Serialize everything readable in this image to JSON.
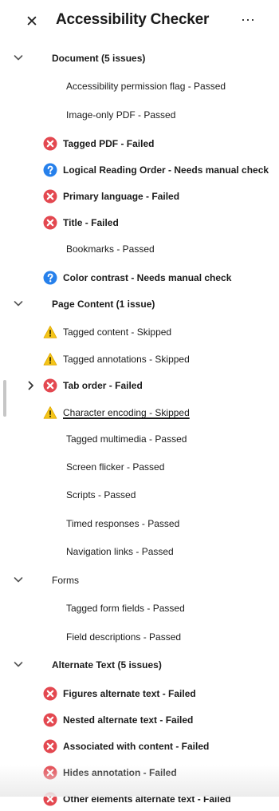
{
  "panel": {
    "title": "Accessibility Checker",
    "close_glyph": "✕",
    "more_glyph": "···"
  },
  "colors": {
    "failed": "#e34850",
    "manual_check": "#2680eb",
    "skipped": "#f5c518",
    "text": "#1b1b1b"
  },
  "rows": [
    {
      "type": "section",
      "label": "Document (5 issues)",
      "expanded": true,
      "icon": "chevron-down-icon"
    },
    {
      "type": "item",
      "label": "Accessibility permission flag - Passed",
      "status": "passed"
    },
    {
      "type": "item",
      "label": "Image-only PDF - Passed",
      "status": "passed"
    },
    {
      "type": "item",
      "label": "Tagged PDF - Failed",
      "status": "failed",
      "icon": "failed-icon"
    },
    {
      "type": "item",
      "label": "Logical Reading Order - Needs manual check",
      "status": "manual",
      "icon": "help-icon"
    },
    {
      "type": "item",
      "label": "Primary language - Failed",
      "status": "failed",
      "icon": "failed-icon"
    },
    {
      "type": "item",
      "label": "Title - Failed",
      "status": "failed",
      "icon": "failed-icon"
    },
    {
      "type": "item",
      "label": "Bookmarks - Passed",
      "status": "passed"
    },
    {
      "type": "item",
      "label": "Color contrast - Needs manual check",
      "status": "manual",
      "icon": "help-icon"
    },
    {
      "type": "section",
      "label": "Page Content (1 issue)",
      "expanded": true,
      "icon": "chevron-down-icon"
    },
    {
      "type": "item",
      "label": "Tagged content - Skipped",
      "status": "skipped",
      "icon": "warning-icon"
    },
    {
      "type": "item",
      "label": "Tagged annotations - Skipped",
      "status": "skipped",
      "icon": "warning-icon"
    },
    {
      "type": "item",
      "label": "Tab order - Failed",
      "status": "failed",
      "icon": "failed-icon",
      "expandable": true
    },
    {
      "type": "item",
      "label": "Character encoding - Skipped",
      "status": "skipped",
      "icon": "warning-icon",
      "underlined": true
    },
    {
      "type": "item",
      "label": "Tagged multimedia - Passed",
      "status": "passed"
    },
    {
      "type": "item",
      "label": "Screen flicker - Passed",
      "status": "passed"
    },
    {
      "type": "item",
      "label": "Scripts - Passed",
      "status": "passed"
    },
    {
      "type": "item",
      "label": "Timed responses - Passed",
      "status": "passed"
    },
    {
      "type": "item",
      "label": "Navigation links - Passed",
      "status": "passed"
    },
    {
      "type": "section",
      "label": "Forms",
      "expanded": true,
      "icon": "chevron-down-icon",
      "bold": false
    },
    {
      "type": "item",
      "label": "Tagged form fields - Passed",
      "status": "passed"
    },
    {
      "type": "item",
      "label": "Field descriptions - Passed",
      "status": "passed"
    },
    {
      "type": "section",
      "label": "Alternate Text (5 issues)",
      "expanded": true,
      "icon": "chevron-down-icon"
    },
    {
      "type": "item",
      "label": "Figures alternate text - Failed",
      "status": "failed",
      "icon": "failed-icon"
    },
    {
      "type": "item",
      "label": "Nested alternate text - Failed",
      "status": "failed",
      "icon": "failed-icon"
    },
    {
      "type": "item",
      "label": "Associated with content - Failed",
      "status": "failed",
      "icon": "failed-icon"
    },
    {
      "type": "item",
      "label": "Hides annotation - Failed",
      "status": "failed",
      "icon": "failed-icon"
    },
    {
      "type": "item",
      "label": "Other elements alternate text - Failed",
      "status": "failed",
      "icon": "failed-icon"
    }
  ]
}
